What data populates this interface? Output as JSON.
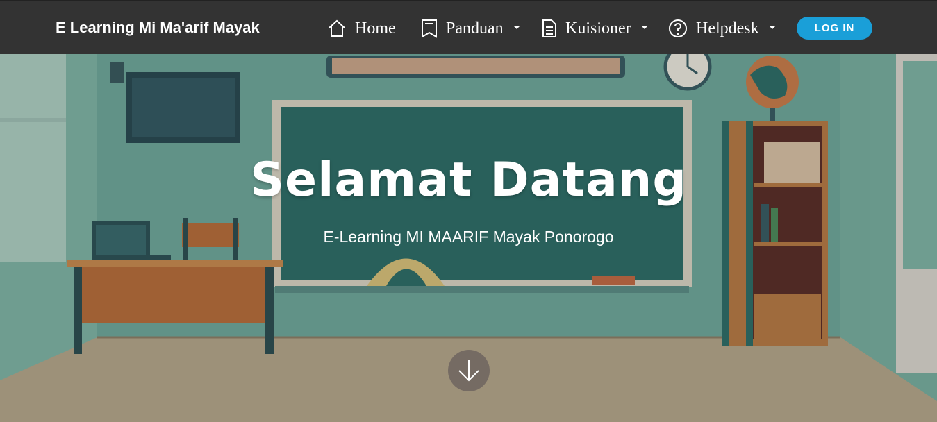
{
  "navbar": {
    "brand": "E Learning Mi Ma'arif Mayak",
    "items": [
      {
        "label": "Home",
        "icon": "home-icon",
        "dropdown": false
      },
      {
        "label": "Panduan",
        "icon": "bookmark-icon",
        "dropdown": true
      },
      {
        "label": "Kuisioner",
        "icon": "document-icon",
        "dropdown": true
      },
      {
        "label": "Helpdesk",
        "icon": "help-circle-icon",
        "dropdown": true
      }
    ],
    "login_label": "LOG IN"
  },
  "hero": {
    "title": "Selamat Datang",
    "subtitle": "E-Learning MI MAARIF Mayak Ponorogo",
    "scroll_icon": "arrow-down-icon"
  },
  "colors": {
    "navbar_bg": "#333333",
    "login_bg": "#1a9fd8",
    "wall": "#6fa79a",
    "board": "#2f6e68"
  }
}
